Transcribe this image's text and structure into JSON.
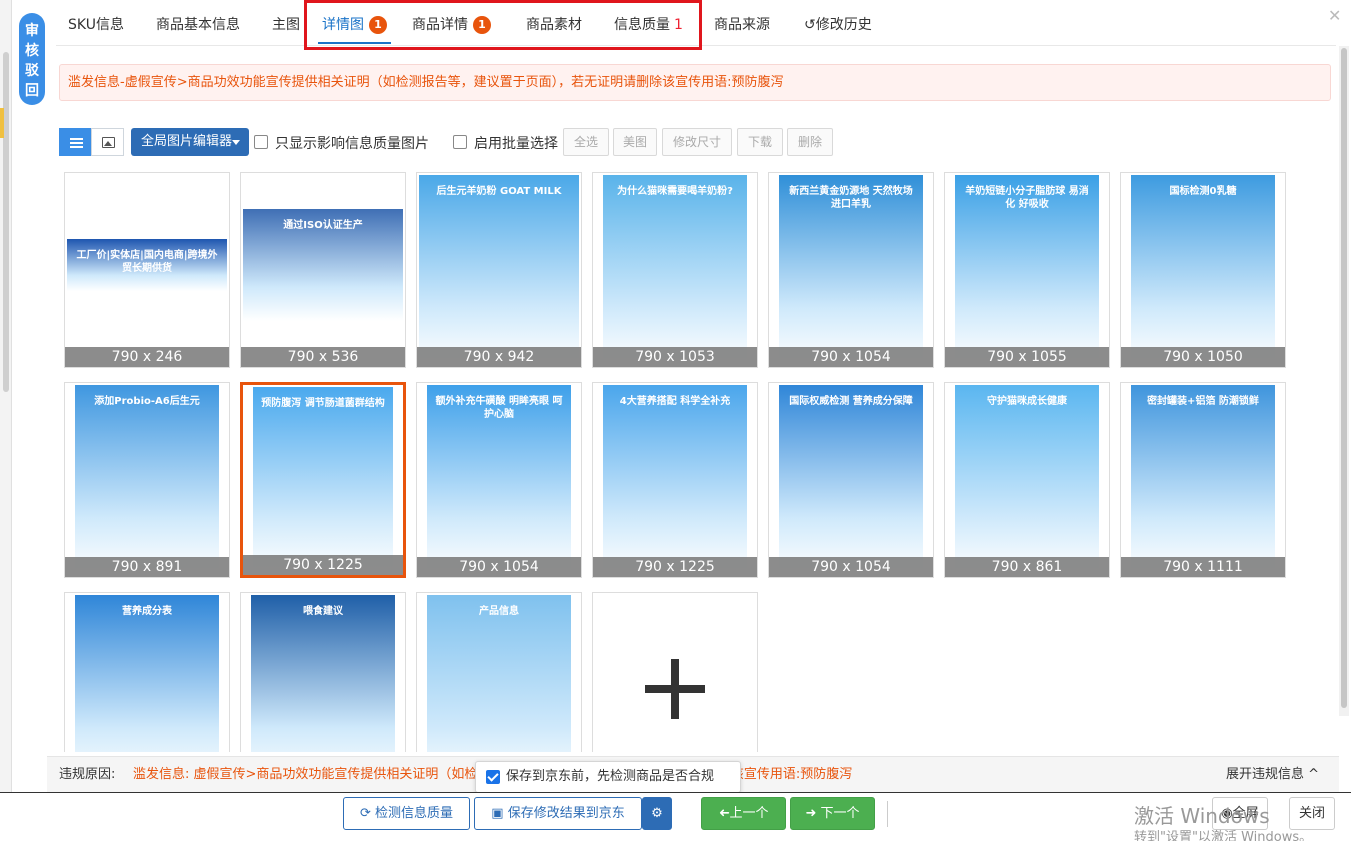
{
  "sidebar": {
    "audit_badge": [
      "审",
      "核",
      "驳",
      "回"
    ]
  },
  "tabs": [
    {
      "label": "SKU信息"
    },
    {
      "label": "商品基本信息"
    },
    {
      "label": "主图"
    },
    {
      "label": "详情图",
      "badge": "1"
    },
    {
      "label": "商品详情",
      "badge": "1"
    },
    {
      "label": "商品素材"
    },
    {
      "label": "信息质量",
      "count": "1"
    },
    {
      "label": "商品来源"
    },
    {
      "label": "修改历史"
    }
  ],
  "alert": {
    "text": "滥发信息-虚假宣传>商品功效功能宣传提供相关证明（如检测报告等，建议置于页面），若无证明请删除该宣传用语:预防腹泻"
  },
  "toolbar": {
    "editor_label": "全局图片编辑器",
    "only_quality_label": "只显示影响信息质量图片",
    "batch_label": "启用批量选择",
    "select_all": "全选",
    "beautify": "美图",
    "resize": "修改尺寸",
    "download": "下载",
    "delete": "删除"
  },
  "images": [
    {
      "size": "790 x 246",
      "title": "工厂价|实体店|国内电商|跨境外贸长期供货",
      "color": "#1e56b0"
    },
    {
      "size": "790 x 536",
      "title": "通过ISO认证生产",
      "color": "#3f6fb5"
    },
    {
      "size": "790 x 942",
      "title": "后生元羊奶粉 GOAT MILK",
      "color": "#4aa8e8"
    },
    {
      "size": "790 x 1053",
      "title": "为什么猫咪需要喝羊奶粉?",
      "color": "#59b3ea"
    },
    {
      "size": "790 x 1054",
      "title": "新西兰黄金奶源地 天然牧场 进口羊乳",
      "color": "#2f8fd8"
    },
    {
      "size": "790 x 1055",
      "title": "羊奶短链小分子脂肪球 易消化 好吸收",
      "color": "#3aa0e6"
    },
    {
      "size": "790 x 1050",
      "title": "国标检测0乳糖",
      "color": "#3d9be0"
    },
    {
      "size": "790 x 891",
      "title": "添加Probio-A6后生元",
      "color": "#3f97e0"
    },
    {
      "size": "790 x 1225",
      "title": "预防腹泻 调节肠道菌群结构",
      "color": "#4aa9ee",
      "selected": true
    },
    {
      "size": "790 x 1054",
      "title": "额外补充牛磺酸 明眸亮眼 呵护心脑",
      "color": "#3ea0ea"
    },
    {
      "size": "790 x 1225",
      "title": "4大营养搭配 科学全补充",
      "color": "#4aa6ec"
    },
    {
      "size": "790 x 1054",
      "title": "国际权威检测 营养成分保障",
      "color": "#2f86d8"
    },
    {
      "size": "790 x 861",
      "title": "守护猫咪成长健康",
      "color": "#5ab6f0"
    },
    {
      "size": "790 x 1111",
      "title": "密封罐装+铝箔 防潮锁鲜",
      "color": "#3f95dd"
    },
    {
      "size": "",
      "title": "营养成分表",
      "color": "#2f86d8"
    },
    {
      "size": "",
      "title": "喂食建议",
      "color": "#1f5fa8"
    },
    {
      "size": "",
      "title": "产品信息",
      "color": "#7fc1ee"
    }
  ],
  "violation": {
    "label": "违规原因:",
    "text": "滥发信息: 虚假宣传>商品功效功能宣传提供相关证明（如检测报告等，建议置于页面），若无证明请删除该宣传用语:预防腹泻",
    "expand": "展开违规信息 ^"
  },
  "tooltip": {
    "text": "保存到京东前，先检测商品是否合规"
  },
  "actions": {
    "check": "检测信息质量",
    "save": "保存修改结果到京东",
    "prev": "上一个",
    "next": "下一个",
    "fullscreen": "全屏",
    "close": "关闭"
  },
  "watermark": {
    "line1": "激活 Windows",
    "line2": "转到\"设置\"以激活 Windows。"
  }
}
